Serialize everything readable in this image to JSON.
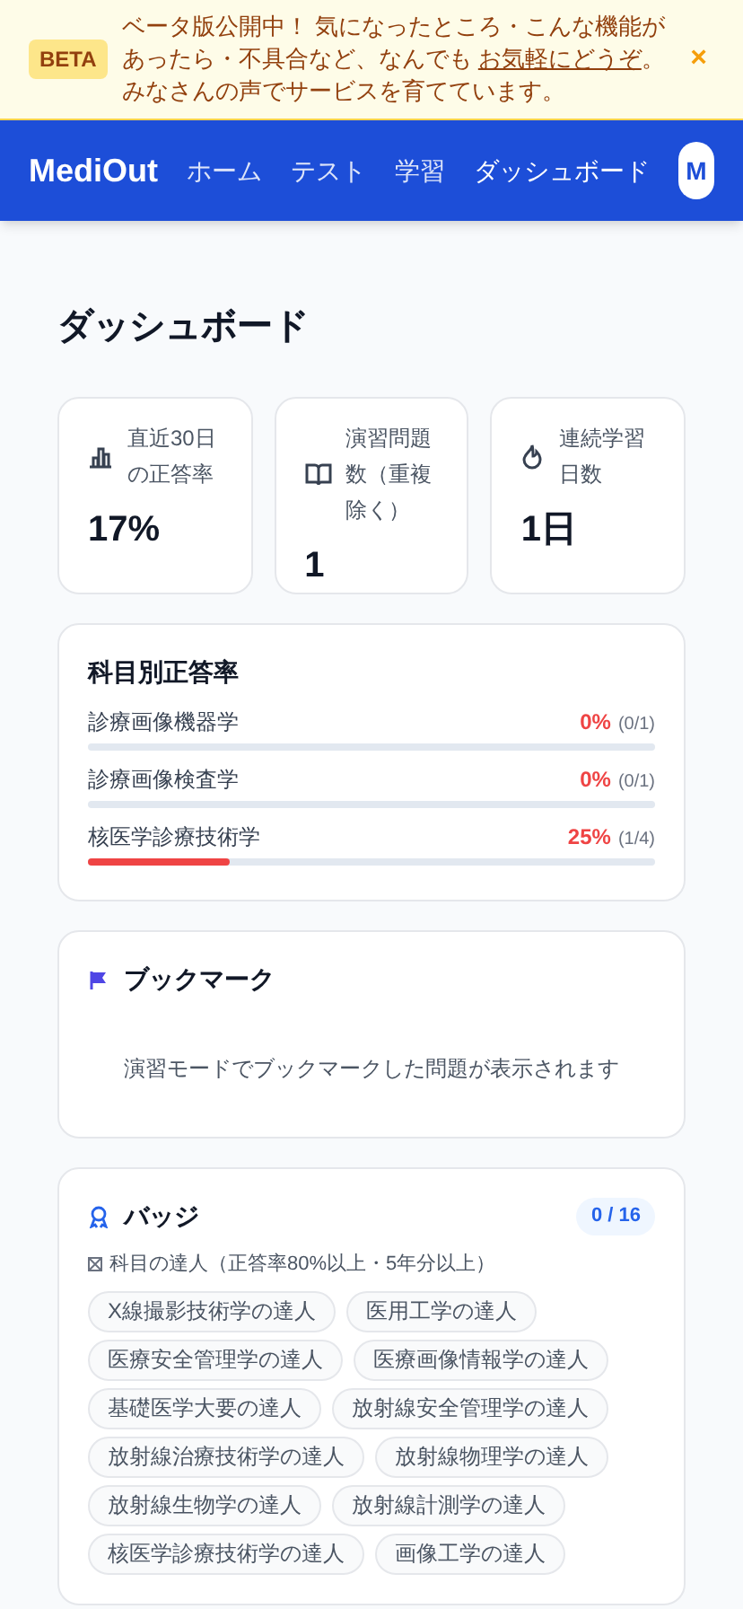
{
  "banner": {
    "badge": "BETA",
    "message_start": "ベータ版公開中！ 気になったところ・こんな機能があったら・不具合など、なんでも",
    "link": "お気軽にどうぞ",
    "message_end": "。みなさんの声でサービスを育てています。",
    "close": "×"
  },
  "nav": {
    "logo": "MediOut",
    "items": [
      {
        "label": "ホーム",
        "selected": false
      },
      {
        "label": "テスト",
        "selected": false
      },
      {
        "label": "学習",
        "selected": false
      },
      {
        "label": "ダッシュボード",
        "selected": true
      }
    ],
    "avatar": "M"
  },
  "page_title": "ダッシュボード",
  "stats": [
    {
      "kind": "chart",
      "label": "直近30日の正答率",
      "value": "17%"
    },
    {
      "kind": "book",
      "label": "演習問題数（重複除く）",
      "value": "1"
    },
    {
      "kind": "flame",
      "label": "連続学習日数",
      "value": "1日"
    }
  ],
  "subjects": {
    "title": "科目別正答率",
    "rows": [
      {
        "name": "診療画像機器学",
        "percent": "0%",
        "count": "(0/1)",
        "level": 0
      },
      {
        "name": "診療画像検査学",
        "percent": "0%",
        "count": "(0/1)",
        "level": 0
      },
      {
        "name": "核医学診療技術学",
        "percent": "25%",
        "count": "(1/4)",
        "level": 0.25
      }
    ]
  },
  "bookmarks": {
    "title": "ブックマーク",
    "empty_message": "演習モードでブックマークした問題が表示されます"
  },
  "badges": {
    "title": "バッジ",
    "count": "0 / 16",
    "category": "科目の達人（正答率80%以上・5年分以上）",
    "items": [
      "X線撮影技術学の達人",
      "医用工学の達人",
      "医療安全管理学の達人",
      "医療画像情報学の達人",
      "基礎医学大要の達人",
      "放射線安全管理学の達人",
      "放射線治療技術学の達人",
      "放射線物理学の達人",
      "放射線生物学の達人",
      "放射線計測学の達人",
      "核医学診療技術学の達人",
      "画像工学の達人"
    ]
  }
}
